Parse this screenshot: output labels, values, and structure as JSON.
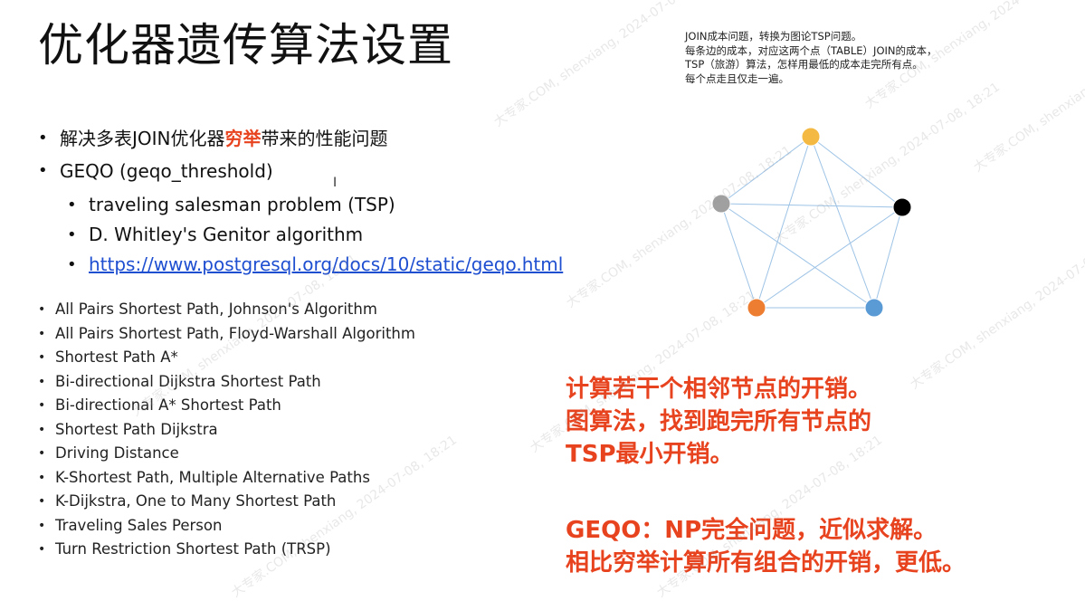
{
  "title": "优化器遗传算法设置",
  "note_lines": [
    "JOIN成本问题，转换为图论TSP问题。",
    "每条边的成本，对应这两个点（TABLE）JOIN的成本，",
    "TSP（旅游）算法，怎样用最低的成本走完所有点。",
    "每个点走且仅走一遍。"
  ],
  "bullets": {
    "b1_pre": "解决多表JOIN优化器",
    "b1_hl": "穷举",
    "b1_post": "带来的性能问题",
    "b2": "GEQO (geqo_threshold)"
  },
  "sub_bullets": {
    "s1": "traveling salesman problem (TSP)",
    "s2": "D. Whitley's Genitor algorithm",
    "s3": "https://www.postgresql.org/docs/10/static/geqo.html"
  },
  "algos": [
    "All Pairs Shortest Path, Johnson's Algorithm",
    "All Pairs Shortest Path, Floyd-Warshall Algorithm",
    "Shortest Path A*",
    "Bi-directional Dijkstra Shortest Path",
    "Bi-directional A* Shortest Path",
    "Shortest Path Dijkstra",
    "Driving Distance",
    "K-Shortest Path, Multiple Alternative Paths",
    "K-Dijkstra, One to Many Shortest Path",
    "Traveling Sales Person",
    "Turn Restriction Shortest Path (TRSP)"
  ],
  "red_block1": [
    "计算若干个相邻节点的开销。",
    "图算法，找到跑完所有节点的",
    "TSP最小开销。"
  ],
  "red_block2": [
    "GEQO：NP完全问题，近似求解。",
    "相比穷举计算所有组合的开销，更低。"
  ],
  "graph": {
    "node_colors": [
      "#f4b942",
      "#000000",
      "#5b9bd5",
      "#ed7d31",
      "#a0a0a0"
    ],
    "edge_color": "#9dc3e6"
  },
  "watermark": "大专家.COM, shenxiang, 2024-07-08, 18:21"
}
